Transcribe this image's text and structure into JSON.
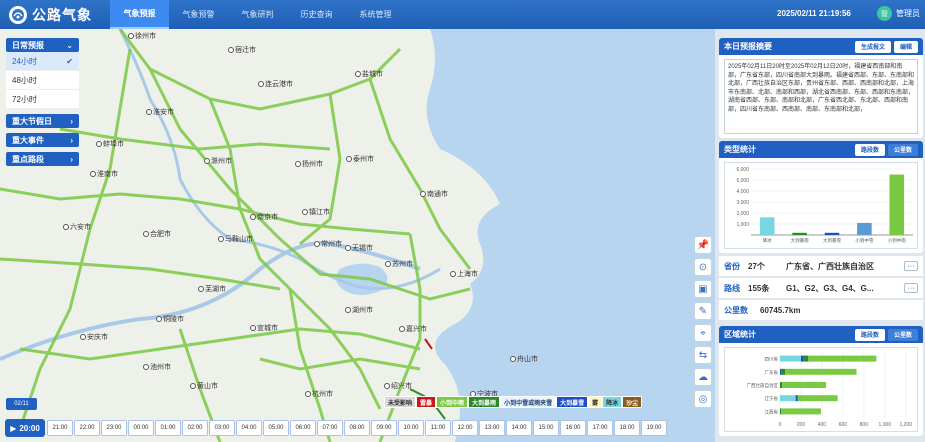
{
  "header": {
    "app_title": "公路气象",
    "nav": [
      "气象预报",
      "气象预警",
      "气象研判",
      "历史查询",
      "系统管理"
    ],
    "active_nav": 0,
    "datetime": "2025/02/11 21:19:56",
    "user_name": "管理员"
  },
  "left_menu": {
    "daily_forecast": "日常预报",
    "sub_items": [
      "24小时",
      "48小时",
      "72小时"
    ],
    "groups": [
      "重大节假日",
      "重大事件",
      "重点路段"
    ]
  },
  "map": {
    "cities": [
      "徐州市",
      "宿迁市",
      "连云港市",
      "盐城市",
      "淮安市",
      "滁州市",
      "扬州市",
      "泰州市",
      "南通市",
      "南京市",
      "镇江市",
      "常州市",
      "无锡市",
      "苏州市",
      "上海市",
      "合肥市",
      "马鞍山市",
      "芜湖市",
      "六安市",
      "铜陵市",
      "宣城市",
      "湖州市",
      "嘉兴市",
      "安庆市",
      "池州市",
      "黄山市",
      "杭州市",
      "绍兴市",
      "舟山市",
      "蚌埠市",
      "宁波市",
      "淮南市"
    ],
    "legend": [
      {
        "label": "未受影响",
        "color": "#d9d9d9",
        "text": "#333"
      },
      {
        "label": "雷暴",
        "color": "#c61a1a",
        "text": "#fff"
      },
      {
        "label": "小到中雨",
        "color": "#7ac943",
        "text": "#fff"
      },
      {
        "label": "大到暴雨",
        "color": "#2a8a2a",
        "text": "#fff"
      },
      {
        "label": "小到中雪或雨夹雪",
        "color": "#e9f4ff",
        "text": "#1f3f70"
      },
      {
        "label": "大到暴雪",
        "color": "#1d4fc2",
        "text": "#fff"
      },
      {
        "label": "雾",
        "color": "#fff6b8",
        "text": "#333"
      },
      {
        "label": "降冰",
        "color": "#77d6e0",
        "text": "#333"
      },
      {
        "label": "沙尘",
        "color": "#8b5a1c",
        "text": "#fff"
      }
    ],
    "date_badge": "02/11"
  },
  "timeline": {
    "start_label": "20:00",
    "hours": [
      "21:00",
      "22:00",
      "23:00",
      "00:00",
      "01:00",
      "02:00",
      "03:00",
      "04:00",
      "05:00",
      "06:00",
      "07:00",
      "08:00",
      "09:00",
      "10:00",
      "11:00",
      "12:00",
      "13:00",
      "14:00",
      "15:00",
      "16:00",
      "17:00",
      "18:00",
      "19:00"
    ]
  },
  "summary_card": {
    "title": "本日预报摘要",
    "btn_generate": "生成报文",
    "btn_edit": "编辑",
    "text": "2025年02月11日20时至2025年02月12日20时，福建省西南部和南部，广东省东部，四川省南部大到暴雨。福建省西部、东部、东南部和北部，广西壮族自治区东部，贵州省东部、西部、西南部和北部，上海市东南部、北部、南部和西部，湖北省西南部、东部、西部和东南部，湖南省西部、东部、南部和北部，广东省西北部、东北部、西部和南部，四川省东南部、西南部、南部、东南部和北部，"
  },
  "type_stats": {
    "title": "类型统计",
    "tab_segments": "路段数",
    "tab_km": "公里数"
  },
  "chart_data": [
    {
      "type": "bar",
      "categories": [
        "降冰",
        "大到暴雨",
        "大到暴雪",
        "小到中雪",
        "小到中雨"
      ],
      "values": [
        1600,
        200,
        200,
        1100,
        5500
      ],
      "yticks": [
        1000,
        2000,
        3000,
        4000,
        5000,
        6000
      ],
      "ylim": [
        0,
        6000
      ],
      "colors": [
        "#77d6e0",
        "#2a8a2a",
        "#1d4fc2",
        "#5b9bd5",
        "#7ac943"
      ]
    },
    {
      "type": "bar",
      "orientation": "horizontal",
      "categories": [
        "四川省",
        "广东省",
        "广西壮族自治区",
        "辽宁省",
        "江西省"
      ],
      "stacked": true,
      "series": [
        {
          "color": "#77d6e0",
          "values": [
            200,
            0,
            0,
            150,
            0
          ]
        },
        {
          "color": "#1d4fc2",
          "values": [
            20,
            10,
            0,
            20,
            0
          ]
        },
        {
          "color": "#2a8a2a",
          "values": [
            50,
            40,
            20,
            0,
            10
          ]
        },
        {
          "color": "#7ac943",
          "values": [
            650,
            680,
            420,
            380,
            380
          ]
        }
      ],
      "xticks": [
        0,
        200,
        400,
        600,
        800,
        1000,
        1200
      ],
      "xlim": [
        0,
        1250
      ]
    }
  ],
  "info": {
    "province_label": "省份",
    "province_count": "27个",
    "province_list": "广东省、广西壮族自治区",
    "route_label": "路线",
    "route_count": "155条",
    "route_list": "G1、G2、G3、G4、G...",
    "km_label": "公里数",
    "km_value": "60745.7km",
    "more": "···"
  },
  "region_stats": {
    "title": "区域统计",
    "tab_segments": "路段数",
    "tab_km": "公里数"
  }
}
